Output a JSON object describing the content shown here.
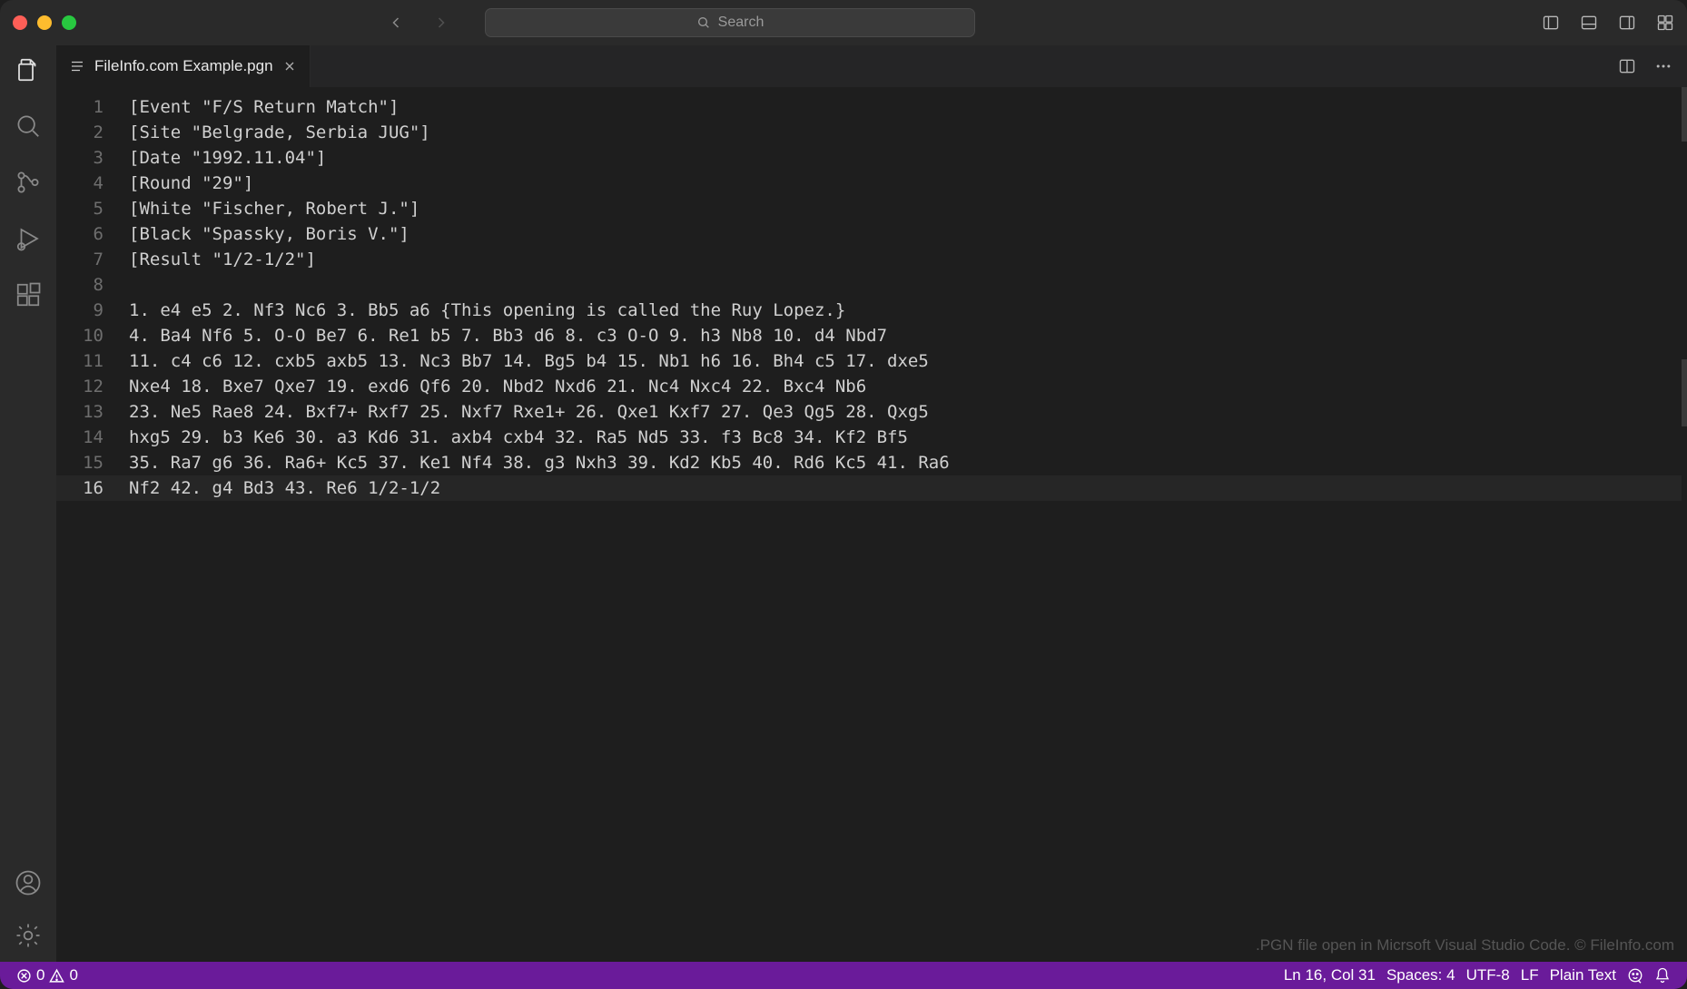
{
  "titlebar": {
    "search_placeholder": "Search"
  },
  "tab": {
    "filename": "FileInfo.com Example.pgn"
  },
  "editor": {
    "lines": [
      "[Event \"F/S Return Match\"]",
      "[Site \"Belgrade, Serbia JUG\"]",
      "[Date \"1992.11.04\"]",
      "[Round \"29\"]",
      "[White \"Fischer, Robert J.\"]",
      "[Black \"Spassky, Boris V.\"]",
      "[Result \"1/2-1/2\"]",
      "",
      "1. e4 e5 2. Nf3 Nc6 3. Bb5 a6 {This opening is called the Ruy Lopez.}",
      "4. Ba4 Nf6 5. O-O Be7 6. Re1 b5 7. Bb3 d6 8. c3 O-O 9. h3 Nb8 10. d4 Nbd7",
      "11. c4 c6 12. cxb5 axb5 13. Nc3 Bb7 14. Bg5 b4 15. Nb1 h6 16. Bh4 c5 17. dxe5",
      "Nxe4 18. Bxe7 Qxe7 19. exd6 Qf6 20. Nbd2 Nxd6 21. Nc4 Nxc4 22. Bxc4 Nb6",
      "23. Ne5 Rae8 24. Bxf7+ Rxf7 25. Nxf7 Rxe1+ 26. Qxe1 Kxf7 27. Qe3 Qg5 28. Qxg5",
      "hxg5 29. b3 Ke6 30. a3 Kd6 31. axb4 cxb4 32. Ra5 Nd5 33. f3 Bc8 34. Kf2 Bf5",
      "35. Ra7 g6 36. Ra6+ Kc5 37. Ke1 Nf4 38. g3 Nxh3 39. Kd2 Kb5 40. Rd6 Kc5 41. Ra6",
      "Nf2 42. g4 Bd3 43. Re6 1/2-1/2"
    ],
    "active_line": 16
  },
  "watermark": ".PGN file open in Micrsoft Visual Studio Code. © FileInfo.com",
  "statusbar": {
    "errors": "0",
    "warnings": "0",
    "cursor": "Ln 16, Col 31",
    "spaces": "Spaces: 4",
    "encoding": "UTF-8",
    "eol": "LF",
    "language": "Plain Text"
  }
}
